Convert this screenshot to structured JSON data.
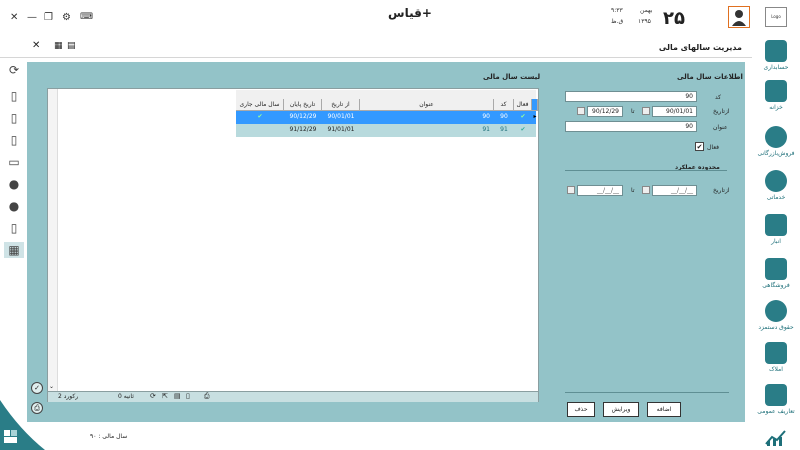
{
  "app": {
    "title": "قیاس+",
    "logo_text": "Logo"
  },
  "date": {
    "day": "۲۵",
    "month": "بهمن",
    "year": "۱۳۹۵",
    "time": "۹:۳۳",
    "ampm": "ق.ظ"
  },
  "page": {
    "title": "مدیریت سالهای مالی"
  },
  "grid": {
    "title": "لیست سال مالی",
    "columns": [
      "فعال",
      "کد",
      "عنوان",
      "از تاریخ",
      "تاریخ پایان",
      "سال مالی جاری"
    ],
    "rows": [
      {
        "active": "✔",
        "code": "90",
        "title": "90",
        "from": "90/01/01",
        "to": "90/12/29",
        "current": "✔"
      },
      {
        "active": "✔",
        "code": "91",
        "title": "91",
        "from": "91/01/01",
        "to": "91/12/29",
        "current": ""
      }
    ],
    "footer": {
      "records": "2 رکورد",
      "seconds": "0 ثانیه"
    }
  },
  "form": {
    "title": "اطلاعات سال مالی",
    "code_label": "کد",
    "code_value": "90",
    "from_label": "ازتاریخ",
    "from_value": "90/01/01",
    "to_label": "تا",
    "to_value": "90/12/29",
    "name_label": "عنوان",
    "name_value": "90",
    "active_label": "فعال",
    "range_title": "محدوده عملکرد",
    "range_from_label": "ازتاریخ",
    "range_from_value": "__/__/__",
    "range_to_label": "تا",
    "range_to_value": "__/__/__"
  },
  "buttons": {
    "add": "اضافه",
    "edit": "ویرایش",
    "delete": "حذف"
  },
  "nav": [
    {
      "label": "حسابداری",
      "icon": "accounting-icon"
    },
    {
      "label": "خزانه",
      "icon": "treasury-icon"
    },
    {
      "label": "فروش‌بازرگانی",
      "icon": "globe-icon"
    },
    {
      "label": "خدماتی",
      "icon": "gear-icon"
    },
    {
      "label": "انبار",
      "icon": "warehouse-icon"
    },
    {
      "label": "فروشگاهی",
      "icon": "store-icon"
    },
    {
      "label": "حقوق دستمزد",
      "icon": "coins-icon"
    },
    {
      "label": "املاک",
      "icon": "house-icon"
    },
    {
      "label": "تعاریف عمومی",
      "icon": "definitions-icon"
    }
  ],
  "status": {
    "fiscal_year": "سال مالی : ۹۰"
  },
  "colors": {
    "accent": "#2a7d87",
    "panel": "#93c3c8",
    "selected_row": "#3399ff",
    "alt_row": "#b8dadd"
  }
}
